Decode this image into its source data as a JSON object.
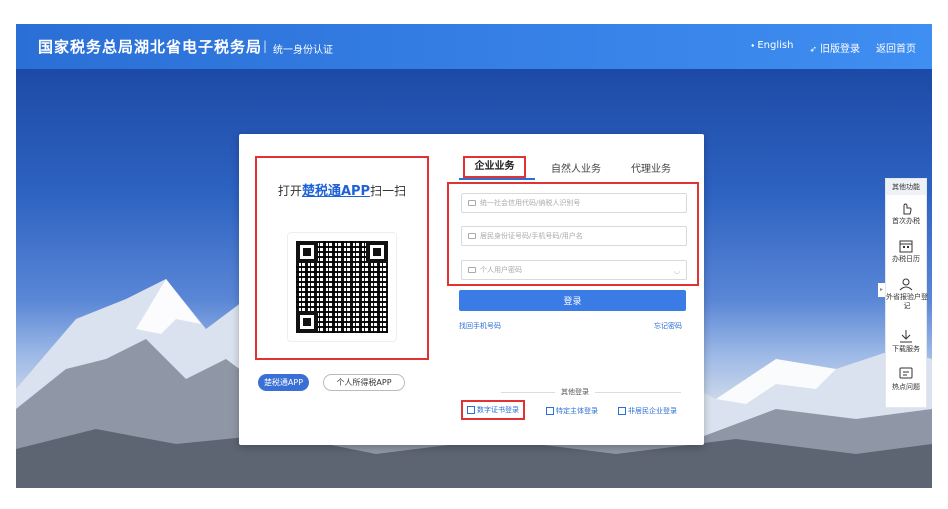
{
  "header": {
    "brand": "国家税务总局湖北省电子税务局",
    "separator": "|",
    "subtitle": "统一身份认证",
    "nav": [
      {
        "icon": "globe-icon",
        "label": "English"
      },
      {
        "icon": "pin-icon",
        "label": "旧版登录"
      },
      {
        "icon": "",
        "label": "返回首页"
      }
    ]
  },
  "qr": {
    "title_prefix": "打开",
    "title_app": "楚税通APP",
    "title_suffix": "扫一扫",
    "buttons": [
      {
        "label": "楚税通APP"
      },
      {
        "label": "个人所得税APP"
      }
    ]
  },
  "tabs": [
    {
      "label": "企业业务"
    },
    {
      "label": "自然人业务"
    },
    {
      "label": "代理业务"
    }
  ],
  "form": {
    "credit_code_placeholder": "统一社会信用代码/纳税人识别号",
    "id_placeholder": "居民身份证号码/手机号码/用户名",
    "password_placeholder": "个人用户密码",
    "login_label": "登录",
    "find_phone_label": "找回手机号码",
    "forgot_password_label": "忘记密码"
  },
  "other_login": {
    "title": "其他登录",
    "options": [
      {
        "label": "数字证书登录"
      },
      {
        "label": "特定主体登录"
      },
      {
        "label": "非居民企业登录"
      }
    ]
  },
  "side": {
    "title": "其他功能",
    "items": [
      {
        "icon": "hand-pointer-icon",
        "label": "首次办税"
      },
      {
        "icon": "calendar-icon",
        "label": "办税日历"
      },
      {
        "icon": "person-icon",
        "label": "外省报验户登记"
      },
      {
        "icon": "download-icon",
        "label": "下载服务"
      },
      {
        "icon": "chat-icon",
        "label": "热点问题"
      }
    ]
  },
  "colors": {
    "accent": "#2a6fd6",
    "highlight_border": "#e03434"
  }
}
